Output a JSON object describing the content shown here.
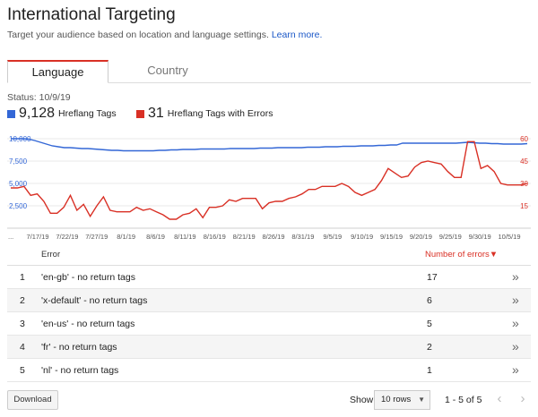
{
  "header": {
    "title": "International Targeting",
    "subtitle": "Target your audience based on location and language settings.",
    "learn_more": "Learn more."
  },
  "tabs": [
    {
      "label": "Language",
      "active": true
    },
    {
      "label": "Country",
      "active": false
    }
  ],
  "status": "Status: 10/9/19",
  "legend": {
    "primary": {
      "value": "9,128",
      "label": "Hreflang Tags",
      "color": "#3367d6"
    },
    "secondary": {
      "value": "31",
      "label": "Hreflang Tags with Errors",
      "color": "#d93025"
    }
  },
  "chart_data": {
    "type": "line",
    "x_tick_labels": [
      "7/17/19",
      "7/22/19",
      "7/27/19",
      "8/1/19",
      "8/6/19",
      "8/11/19",
      "8/16/19",
      "8/21/19",
      "8/26/19",
      "8/31/19",
      "9/5/19",
      "9/10/19",
      "9/15/19",
      "9/20/19",
      "9/25/19",
      "9/30/19",
      "10/5/19"
    ],
    "y_left_ticks": [
      "10,000",
      "7,500",
      "5,000",
      "2,500"
    ],
    "y_left_ticks_values": [
      10000,
      7500,
      5000,
      2500
    ],
    "y_left_range": [
      0,
      10000
    ],
    "y_right_ticks": [
      "60",
      "45",
      "30",
      "15"
    ],
    "y_right_ticks_values": [
      60,
      45,
      30,
      15
    ],
    "y_right_range": [
      0,
      60
    ],
    "x_ellipsis": "...",
    "series": [
      {
        "name": "Hreflang Tags",
        "axis": "left",
        "color": "#3367d6",
        "values": [
          10000,
          10000,
          10000,
          9950,
          9800,
          9600,
          9400,
          9200,
          9100,
          9000,
          9000,
          8950,
          8900,
          8900,
          8850,
          8800,
          8750,
          8700,
          8700,
          8650,
          8650,
          8650,
          8650,
          8650,
          8650,
          8700,
          8700,
          8750,
          8750,
          8800,
          8800,
          8800,
          8850,
          8850,
          8850,
          8850,
          8850,
          8900,
          8900,
          8900,
          8900,
          8900,
          8950,
          8950,
          8950,
          9000,
          9000,
          9000,
          9000,
          9000,
          9050,
          9050,
          9050,
          9100,
          9100,
          9100,
          9150,
          9150,
          9150,
          9200,
          9200,
          9200,
          9250,
          9250,
          9300,
          9300,
          9500,
          9500,
          9500,
          9500,
          9500,
          9500,
          9500,
          9500,
          9500,
          9500,
          9550,
          9600,
          9550,
          9500,
          9500,
          9450,
          9450,
          9400,
          9400,
          9400,
          9400,
          9450
        ]
      },
      {
        "name": "Hreflang Tags with Errors",
        "axis": "right",
        "color": "#d93025",
        "values": [
          27,
          27,
          28,
          22,
          23,
          18,
          10,
          10,
          14,
          22,
          12,
          16,
          8,
          15,
          21,
          12,
          11,
          11,
          11,
          14,
          12,
          13,
          11,
          9,
          6,
          6,
          9,
          10,
          13,
          7,
          14,
          14,
          15,
          19,
          18,
          20,
          20,
          20,
          13,
          17,
          18,
          18,
          20,
          21,
          23,
          26,
          26,
          28,
          28,
          28,
          30,
          28,
          24,
          22,
          24,
          26,
          32,
          40,
          37,
          34,
          35,
          41,
          44,
          45,
          44,
          43,
          38,
          34,
          34,
          58,
          58,
          40,
          42,
          38,
          30,
          29,
          29,
          29,
          30
        ]
      }
    ]
  },
  "table": {
    "headers": {
      "error": "Error",
      "count": "Number of errors▼"
    },
    "rows": [
      {
        "index": "1",
        "error": "'en-gb' - no return tags",
        "count": "17"
      },
      {
        "index": "2",
        "error": "'x-default' - no return tags",
        "count": "6"
      },
      {
        "index": "3",
        "error": "'en-us' - no return tags",
        "count": "5"
      },
      {
        "index": "4",
        "error": "'fr' - no return tags",
        "count": "2"
      },
      {
        "index": "5",
        "error": "'nl' - no return tags",
        "count": "1"
      }
    ],
    "row_action_icon": "»"
  },
  "footer": {
    "download": "Download",
    "show_label": "Show",
    "rows_option": "10 rows",
    "pager_info": "1 - 5 of 5",
    "prev_icon": "‹",
    "next_icon": "›"
  }
}
